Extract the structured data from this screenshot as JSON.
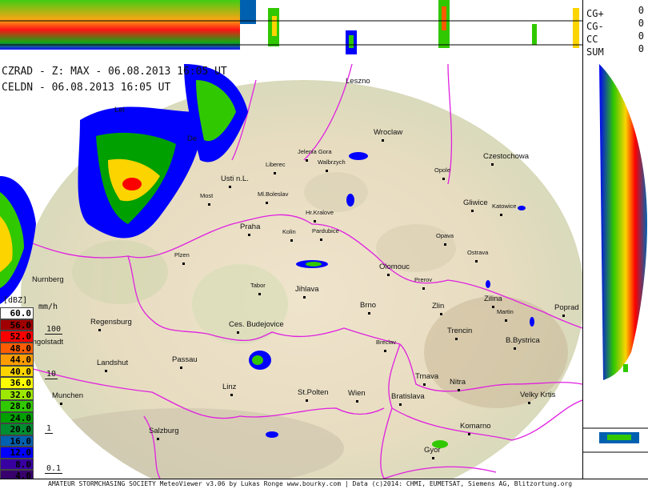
{
  "header": {
    "line1": "CZRAD - Z: MAX - 06.08.2013 16:05 UT",
    "line2": "CELDN - 06.08.2013 16:05 UT"
  },
  "lightning_stats": [
    {
      "label": "CG+",
      "value": "0"
    },
    {
      "label": "CG-",
      "value": "0"
    },
    {
      "label": "CC",
      "value": "0"
    },
    {
      "label": "SUM",
      "value": "0"
    }
  ],
  "legend": {
    "unit_dbz": "[dBZ]",
    "unit_mmh": "mm/h",
    "steps": [
      {
        "dbz": "60.0",
        "color": "#ffffff",
        "text": "#000000"
      },
      {
        "dbz": "56.0",
        "color": "#a00000",
        "text": "#000000"
      },
      {
        "dbz": "52.0",
        "color": "#fc0000",
        "text": "#000000"
      },
      {
        "dbz": "48.0",
        "color": "#fc5c00",
        "text": "#000000"
      },
      {
        "dbz": "44.0",
        "color": "#fc9c00",
        "text": "#000000"
      },
      {
        "dbz": "40.0",
        "color": "#fcd400",
        "text": "#000000"
      },
      {
        "dbz": "36.0",
        "color": "#fcfc00",
        "text": "#000000"
      },
      {
        "dbz": "32.0",
        "color": "#9ce800",
        "text": "#000000"
      },
      {
        "dbz": "28.0",
        "color": "#30c800",
        "text": "#000000"
      },
      {
        "dbz": "24.0",
        "color": "#00a000",
        "text": "#000000"
      },
      {
        "dbz": "20.0",
        "color": "#008c30",
        "text": "#000000"
      },
      {
        "dbz": "16.0",
        "color": "#0060b0",
        "text": "#000000"
      },
      {
        "dbz": "12.0",
        "color": "#0000fc",
        "text": "#000000"
      },
      {
        "dbz": "8.0",
        "color": "#3800a0",
        "text": "#000000"
      },
      {
        "dbz": "4.0",
        "color": "#38006c",
        "text": "#000000"
      }
    ],
    "mmh_marks": [
      "100",
      "10",
      "1",
      "0.1"
    ]
  },
  "cities": [
    {
      "name": "Leszno",
      "cls": "",
      "dot": false
    },
    {
      "name": "Wroclaw",
      "cls": "",
      "dot": true
    },
    {
      "name": "Jelenia Gora",
      "cls": "sm",
      "dot": true
    },
    {
      "name": "Walbrzych",
      "cls": "sm",
      "dot": true
    },
    {
      "name": "Czestochowa",
      "cls": "",
      "dot": true
    },
    {
      "name": "Opole",
      "cls": "sm",
      "dot": true
    },
    {
      "name": "Liberec",
      "cls": "sm",
      "dot": true
    },
    {
      "name": "Usti n.L.",
      "cls": "",
      "dot": true
    },
    {
      "name": "Most",
      "cls": "sm",
      "dot": true
    },
    {
      "name": "Ml.Boleslav",
      "cls": "sm",
      "dot": true
    },
    {
      "name": "Gliwice",
      "cls": "",
      "dot": true
    },
    {
      "name": "Katowice",
      "cls": "sm",
      "dot": true
    },
    {
      "name": "Hr.Kralove",
      "cls": "sm",
      "dot": true
    },
    {
      "name": "Praha",
      "cls": "",
      "dot": true
    },
    {
      "name": "Kolin",
      "cls": "sm",
      "dot": true
    },
    {
      "name": "Pardubice",
      "cls": "sm",
      "dot": true
    },
    {
      "name": "Opava",
      "cls": "sm",
      "dot": true
    },
    {
      "name": "Ostrava",
      "cls": "sm",
      "dot": true
    },
    {
      "name": "Plzen",
      "cls": "sm",
      "dot": true
    },
    {
      "name": "Olomouc",
      "cls": "",
      "dot": true
    },
    {
      "name": "Prerov",
      "cls": "sm",
      "dot": true
    },
    {
      "name": "Tabor",
      "cls": "sm",
      "dot": true
    },
    {
      "name": "Jihlava",
      "cls": "",
      "dot": true
    },
    {
      "name": "Zilina",
      "cls": "",
      "dot": true
    },
    {
      "name": "Martin",
      "cls": "sm",
      "dot": true
    },
    {
      "name": "Poprad",
      "cls": "",
      "dot": true
    },
    {
      "name": "Nurnberg",
      "cls": "",
      "dot": false
    },
    {
      "name": "Brno",
      "cls": "",
      "dot": true
    },
    {
      "name": "Zlin",
      "cls": "",
      "dot": true
    },
    {
      "name": "Regensburg",
      "cls": "",
      "dot": true
    },
    {
      "name": "Ces. Budejovice",
      "cls": "",
      "dot": true
    },
    {
      "name": "Trencin",
      "cls": "",
      "dot": true
    },
    {
      "name": "Ingolstadt",
      "cls": "",
      "dot": false
    },
    {
      "name": "Breclav",
      "cls": "sm",
      "dot": true
    },
    {
      "name": "B.Bystrica",
      "cls": "",
      "dot": true
    },
    {
      "name": "Passau",
      "cls": "",
      "dot": true
    },
    {
      "name": "Landshut",
      "cls": "",
      "dot": true
    },
    {
      "name": "Trnava",
      "cls": "",
      "dot": true
    },
    {
      "name": "Nitra",
      "cls": "",
      "dot": true
    },
    {
      "name": "Linz",
      "cls": "",
      "dot": true
    },
    {
      "name": "St.Polten",
      "cls": "",
      "dot": true
    },
    {
      "name": "Wien",
      "cls": "",
      "dot": true
    },
    {
      "name": "Bratislava",
      "cls": "",
      "dot": true
    },
    {
      "name": "Velky Krtis",
      "cls": "",
      "dot": true
    },
    {
      "name": "Munchen",
      "cls": "",
      "dot": true
    },
    {
      "name": "Komarno",
      "cls": "",
      "dot": true
    },
    {
      "name": "Salzburg",
      "cls": "",
      "dot": true
    },
    {
      "name": "Gyor",
      "cls": "",
      "dot": true
    },
    {
      "name": "Lei",
      "cls": "",
      "dot": false
    },
    {
      "name": "De",
      "cls": "",
      "dot": false
    }
  ],
  "footer": "AMATEUR STORMCHASING SOCIETY MeteoViewer v3.06 by Lukas Ronge www.bourky.com | Data (c)2014: CHMI, EUMETSAT, Siemens AG, Blitzortung.org"
}
